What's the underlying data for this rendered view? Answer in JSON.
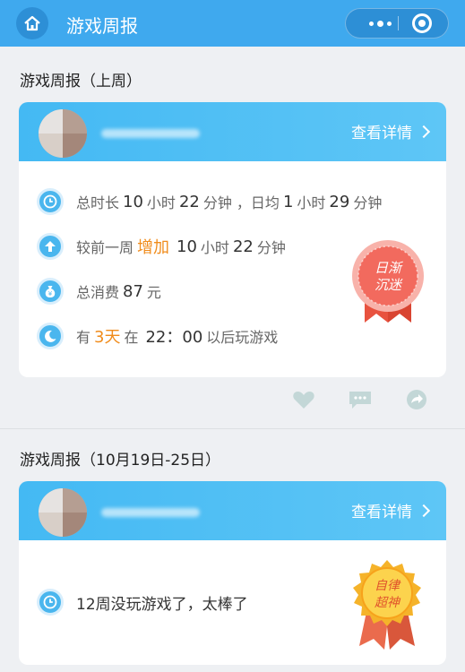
{
  "header": {
    "title": "游戏周报"
  },
  "sections": [
    {
      "title": "游戏周报（上周）",
      "card": {
        "detail_label": "查看详情",
        "rows": {
          "r1": {
            "a": "总时长",
            "h": "10",
            "b": "小时",
            "m": "22",
            "c": "分钟 ，日均",
            "h2": "1",
            "d": "小时",
            "m2": "29",
            "e": "分钟"
          },
          "r2": {
            "a": "较前一周",
            "change": "增加",
            "h": "10",
            "b": "小时",
            "m": "22",
            "c": "分钟"
          },
          "r3": {
            "a": "总消费",
            "amount": "87",
            "b": "元"
          },
          "r4": {
            "a": "有",
            "days": "3天",
            "b": "在",
            "time": "22：00",
            "c": "以后玩游戏"
          }
        },
        "badge": {
          "line1": "日渐",
          "line2": "沉迷",
          "color": "#f26a5e"
        }
      }
    },
    {
      "title": "游戏周报（10月19日-25日）",
      "card": {
        "detail_label": "查看详情",
        "message": "12周没玩游戏了，太棒了",
        "badge": {
          "line1": "自律",
          "line2": "超神",
          "color": "#f5b32a"
        }
      }
    }
  ],
  "icons": [
    "home-icon",
    "more-dots-icon",
    "close-target-icon",
    "clock-icon",
    "arrow-up-icon",
    "money-bag-icon",
    "moon-icon",
    "heart-icon",
    "comment-icon",
    "share-icon",
    "chevron-right-icon"
  ]
}
